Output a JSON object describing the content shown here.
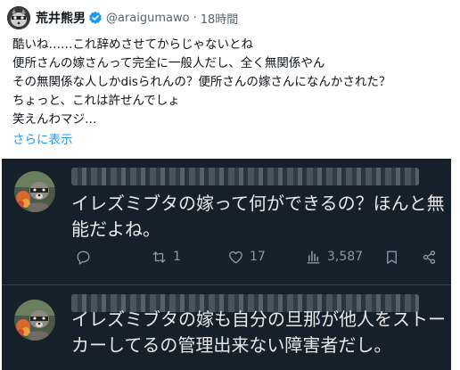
{
  "tweet": {
    "author_name": "荒井熊男",
    "handle": "@araigumawo",
    "separator": "·",
    "time": "18時間",
    "lines": [
      "酷いね……これ辞めさせてからじゃないとね",
      "便所さんの嫁さんって完全に一般人だし、全く無関係やん",
      "その無関係な人しかdisられんの？便所さんの嫁さんになんかされた？",
      "ちょっと、これは許せんでしょ",
      "笑えんわマジ…"
    ],
    "show_more": "さらに表示",
    "verified_color": "#1d9bf0"
  },
  "embedded": [
    {
      "text_lines": [
        "イレズミブタの嫁って何ができるの？ほんと無",
        "能だよね。"
      ],
      "actions": {
        "reply_icon": "reply-icon",
        "retweet_icon": "retweet-icon",
        "retweet_count": "1",
        "like_icon": "heart-icon",
        "like_count": "17",
        "views_icon": "views-icon",
        "views_count": "3,587",
        "bookmark_icon": "bookmark-icon",
        "share_icon": "share-icon"
      }
    },
    {
      "text_lines": [
        "イレズミブタの嫁も自分の旦那が他人をストー",
        "カーしてるの管理出来ない障害者だし。"
      ]
    }
  ],
  "colors": {
    "dark_background": "#15202b",
    "dark_text": "#e7e9ea",
    "action_gray": "#8b98a5",
    "link_blue": "#1d9bf0"
  }
}
